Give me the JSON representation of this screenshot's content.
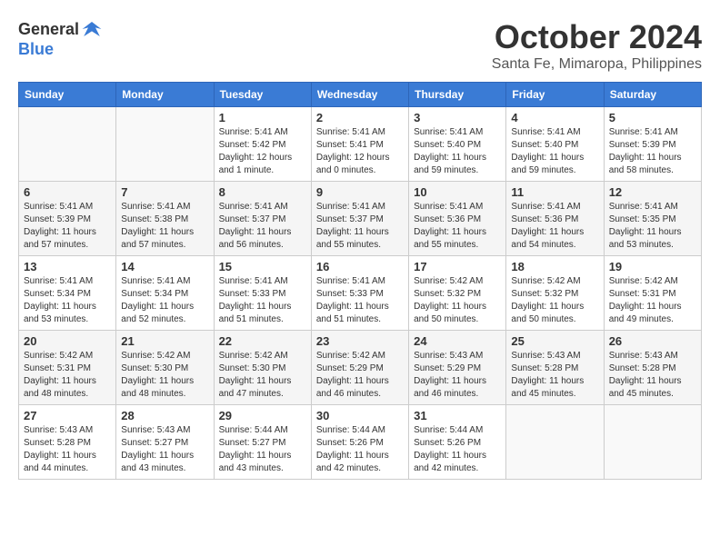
{
  "logo": {
    "general": "General",
    "blue": "Blue"
  },
  "title": "October 2024",
  "subtitle": "Santa Fe, Mimaropa, Philippines",
  "days_of_week": [
    "Sunday",
    "Monday",
    "Tuesday",
    "Wednesday",
    "Thursday",
    "Friday",
    "Saturday"
  ],
  "weeks": [
    {
      "shaded": false,
      "days": [
        {
          "number": "",
          "info": ""
        },
        {
          "number": "",
          "info": ""
        },
        {
          "number": "1",
          "info": "Sunrise: 5:41 AM\nSunset: 5:42 PM\nDaylight: 12 hours\nand 1 minute."
        },
        {
          "number": "2",
          "info": "Sunrise: 5:41 AM\nSunset: 5:41 PM\nDaylight: 12 hours\nand 0 minutes."
        },
        {
          "number": "3",
          "info": "Sunrise: 5:41 AM\nSunset: 5:40 PM\nDaylight: 11 hours\nand 59 minutes."
        },
        {
          "number": "4",
          "info": "Sunrise: 5:41 AM\nSunset: 5:40 PM\nDaylight: 11 hours\nand 59 minutes."
        },
        {
          "number": "5",
          "info": "Sunrise: 5:41 AM\nSunset: 5:39 PM\nDaylight: 11 hours\nand 58 minutes."
        }
      ]
    },
    {
      "shaded": true,
      "days": [
        {
          "number": "6",
          "info": "Sunrise: 5:41 AM\nSunset: 5:39 PM\nDaylight: 11 hours\nand 57 minutes."
        },
        {
          "number": "7",
          "info": "Sunrise: 5:41 AM\nSunset: 5:38 PM\nDaylight: 11 hours\nand 57 minutes."
        },
        {
          "number": "8",
          "info": "Sunrise: 5:41 AM\nSunset: 5:37 PM\nDaylight: 11 hours\nand 56 minutes."
        },
        {
          "number": "9",
          "info": "Sunrise: 5:41 AM\nSunset: 5:37 PM\nDaylight: 11 hours\nand 55 minutes."
        },
        {
          "number": "10",
          "info": "Sunrise: 5:41 AM\nSunset: 5:36 PM\nDaylight: 11 hours\nand 55 minutes."
        },
        {
          "number": "11",
          "info": "Sunrise: 5:41 AM\nSunset: 5:36 PM\nDaylight: 11 hours\nand 54 minutes."
        },
        {
          "number": "12",
          "info": "Sunrise: 5:41 AM\nSunset: 5:35 PM\nDaylight: 11 hours\nand 53 minutes."
        }
      ]
    },
    {
      "shaded": false,
      "days": [
        {
          "number": "13",
          "info": "Sunrise: 5:41 AM\nSunset: 5:34 PM\nDaylight: 11 hours\nand 53 minutes."
        },
        {
          "number": "14",
          "info": "Sunrise: 5:41 AM\nSunset: 5:34 PM\nDaylight: 11 hours\nand 52 minutes."
        },
        {
          "number": "15",
          "info": "Sunrise: 5:41 AM\nSunset: 5:33 PM\nDaylight: 11 hours\nand 51 minutes."
        },
        {
          "number": "16",
          "info": "Sunrise: 5:41 AM\nSunset: 5:33 PM\nDaylight: 11 hours\nand 51 minutes."
        },
        {
          "number": "17",
          "info": "Sunrise: 5:42 AM\nSunset: 5:32 PM\nDaylight: 11 hours\nand 50 minutes."
        },
        {
          "number": "18",
          "info": "Sunrise: 5:42 AM\nSunset: 5:32 PM\nDaylight: 11 hours\nand 50 minutes."
        },
        {
          "number": "19",
          "info": "Sunrise: 5:42 AM\nSunset: 5:31 PM\nDaylight: 11 hours\nand 49 minutes."
        }
      ]
    },
    {
      "shaded": true,
      "days": [
        {
          "number": "20",
          "info": "Sunrise: 5:42 AM\nSunset: 5:31 PM\nDaylight: 11 hours\nand 48 minutes."
        },
        {
          "number": "21",
          "info": "Sunrise: 5:42 AM\nSunset: 5:30 PM\nDaylight: 11 hours\nand 48 minutes."
        },
        {
          "number": "22",
          "info": "Sunrise: 5:42 AM\nSunset: 5:30 PM\nDaylight: 11 hours\nand 47 minutes."
        },
        {
          "number": "23",
          "info": "Sunrise: 5:42 AM\nSunset: 5:29 PM\nDaylight: 11 hours\nand 46 minutes."
        },
        {
          "number": "24",
          "info": "Sunrise: 5:43 AM\nSunset: 5:29 PM\nDaylight: 11 hours\nand 46 minutes."
        },
        {
          "number": "25",
          "info": "Sunrise: 5:43 AM\nSunset: 5:28 PM\nDaylight: 11 hours\nand 45 minutes."
        },
        {
          "number": "26",
          "info": "Sunrise: 5:43 AM\nSunset: 5:28 PM\nDaylight: 11 hours\nand 45 minutes."
        }
      ]
    },
    {
      "shaded": false,
      "days": [
        {
          "number": "27",
          "info": "Sunrise: 5:43 AM\nSunset: 5:28 PM\nDaylight: 11 hours\nand 44 minutes."
        },
        {
          "number": "28",
          "info": "Sunrise: 5:43 AM\nSunset: 5:27 PM\nDaylight: 11 hours\nand 43 minutes."
        },
        {
          "number": "29",
          "info": "Sunrise: 5:44 AM\nSunset: 5:27 PM\nDaylight: 11 hours\nand 43 minutes."
        },
        {
          "number": "30",
          "info": "Sunrise: 5:44 AM\nSunset: 5:26 PM\nDaylight: 11 hours\nand 42 minutes."
        },
        {
          "number": "31",
          "info": "Sunrise: 5:44 AM\nSunset: 5:26 PM\nDaylight: 11 hours\nand 42 minutes."
        },
        {
          "number": "",
          "info": ""
        },
        {
          "number": "",
          "info": ""
        }
      ]
    }
  ]
}
